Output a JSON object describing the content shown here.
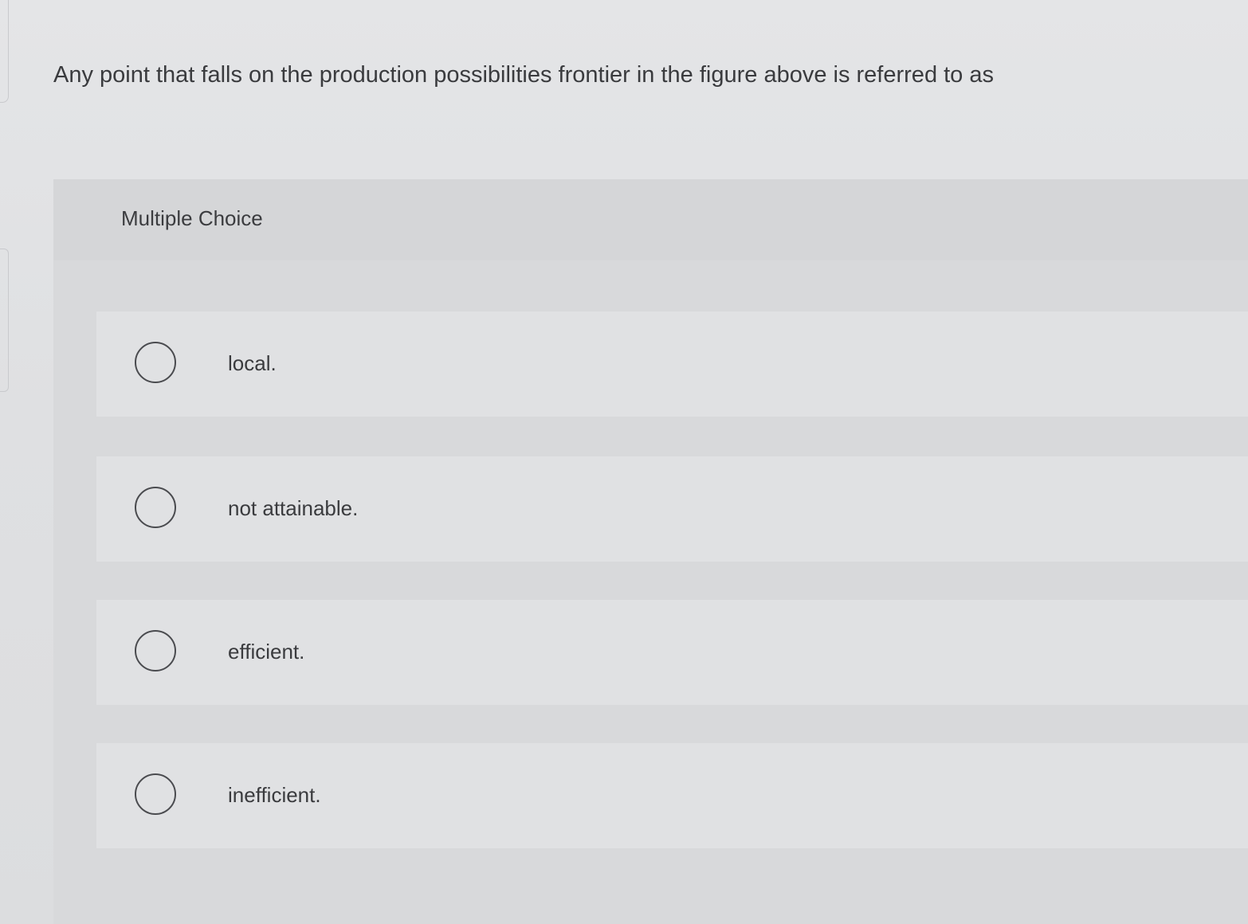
{
  "question": {
    "text": "Any point that falls on the production possibilities frontier in the figure above is referred to as"
  },
  "section": {
    "label": "Multiple Choice"
  },
  "options": [
    {
      "label": "local.",
      "selected": false
    },
    {
      "label": "not attainable.",
      "selected": false
    },
    {
      "label": "efficient.",
      "selected": false
    },
    {
      "label": "inefficient.",
      "selected": false
    }
  ],
  "colors": {
    "background": "#e2e3e5",
    "panel": "#d8d9db",
    "option_card": "#e0e1e3",
    "text": "#3a3b3e",
    "radio_border": "#4a4b4f"
  }
}
